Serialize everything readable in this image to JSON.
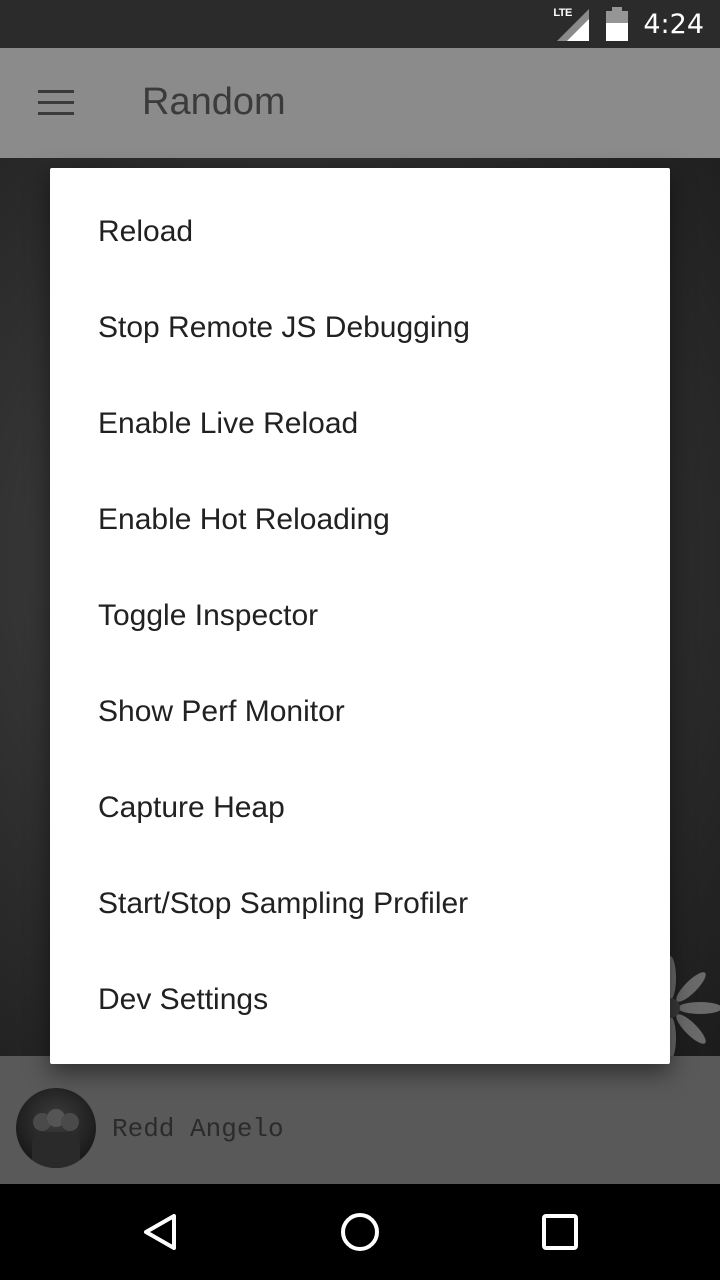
{
  "status_bar": {
    "network": "LTE",
    "time": "4:24"
  },
  "app_bar": {
    "menu_icon": "hamburger-menu-icon",
    "title": "Random"
  },
  "dev_menu": {
    "items": [
      {
        "label": "Reload"
      },
      {
        "label": "Stop Remote JS Debugging"
      },
      {
        "label": "Enable Live Reload"
      },
      {
        "label": "Enable Hot Reloading"
      },
      {
        "label": "Toggle Inspector"
      },
      {
        "label": "Show Perf Monitor"
      },
      {
        "label": "Capture Heap"
      },
      {
        "label": "Start/Stop Sampling Profiler"
      },
      {
        "label": "Dev Settings"
      }
    ]
  },
  "author": {
    "name": "Redd Angelo"
  },
  "nav_bar": {
    "back_icon": "back-triangle-icon",
    "home_icon": "home-circle-icon",
    "recents_icon": "recents-square-icon"
  },
  "colors": {
    "status_bar": "#2b2b2b",
    "app_bar_dimmed": "#8b8b8b",
    "dialog_bg": "#ffffff",
    "dialog_text": "#212121",
    "nav_bar": "#000000"
  }
}
